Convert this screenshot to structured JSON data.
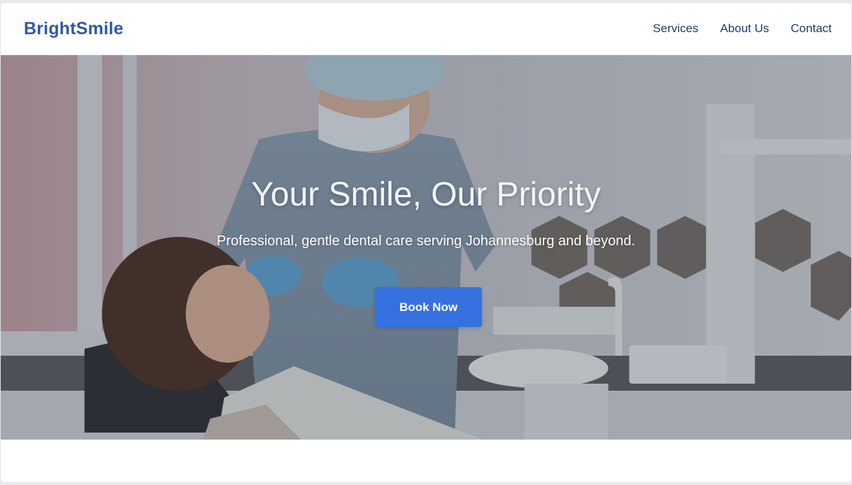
{
  "brand": {
    "name": "BrightSmile"
  },
  "nav": {
    "items": [
      {
        "label": "Services"
      },
      {
        "label": "About Us"
      },
      {
        "label": "Contact"
      }
    ]
  },
  "hero": {
    "title": "Your Smile, Our Priority",
    "subtitle": "Professional, gentle dental care serving Johannesburg and beyond.",
    "cta_label": "Book Now",
    "image_alt": "Dentist examining a smiling patient"
  },
  "colors": {
    "brand": "#2f5aa8",
    "nav_text": "#1e3d66",
    "cta": "#3672df"
  }
}
